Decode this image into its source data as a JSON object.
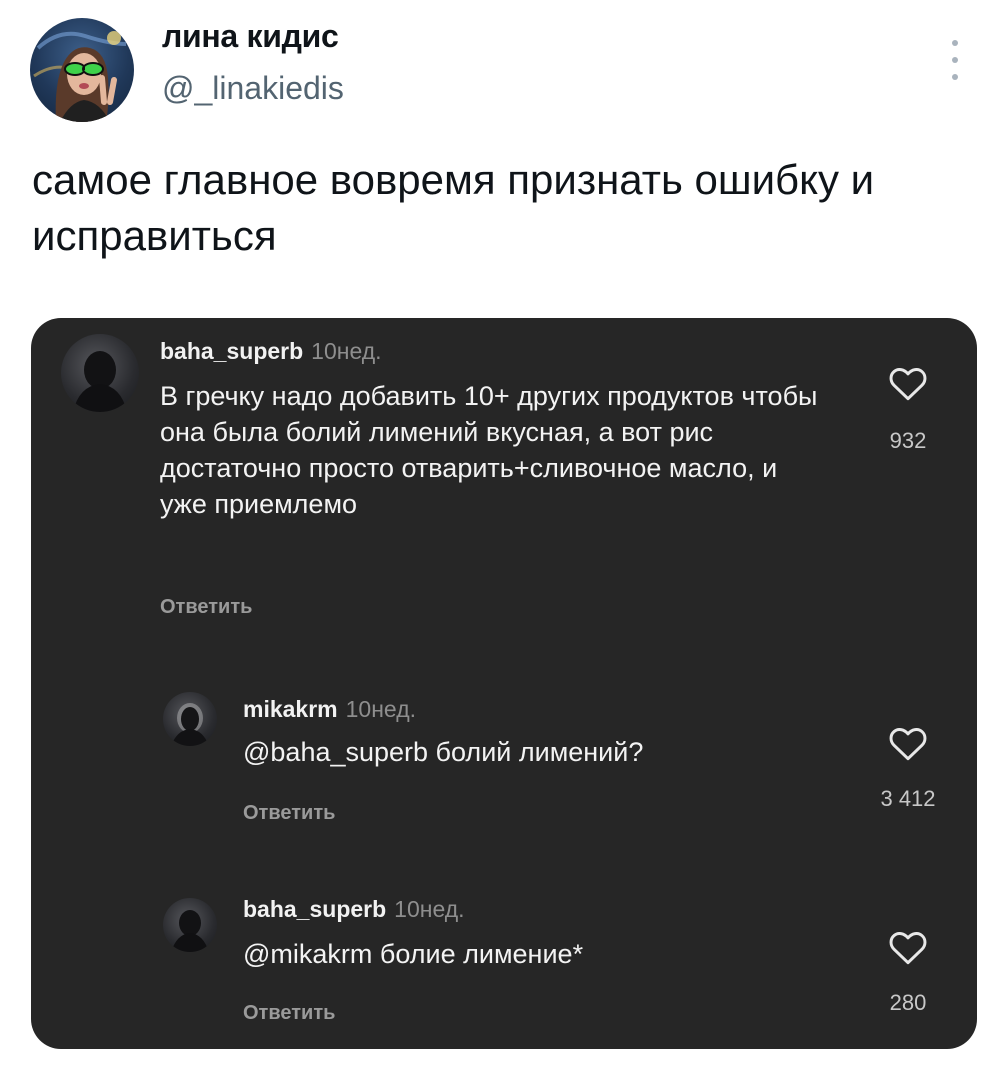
{
  "tweet": {
    "author_name": "лина кидис",
    "author_handle": "@_linakiedis",
    "text": "самое главное вовремя признать ошибку и исправиться"
  },
  "comments": [
    {
      "user": "baha_superb",
      "time": "10нед.",
      "text": "В гречку надо добавить 10+ других продуктов чтобы она была болий лимений вкусная, а вот рис достаточно просто отварить+сливочное масло, и уже приемлемо",
      "reply_label": "Ответить",
      "likes": "932"
    },
    {
      "user": "mikakrm",
      "time": "10нед.",
      "text": "@baha_superb болий лимений?",
      "reply_label": "Ответить",
      "likes": "3 412"
    },
    {
      "user": "baha_superb",
      "time": "10нед.",
      "text": "@mikakrm болие лимение*",
      "reply_label": "Ответить",
      "likes": "280"
    }
  ],
  "icons": {
    "more": "more-vertical-icon",
    "like": "heart-outline-icon"
  },
  "colors": {
    "background": "#ffffff",
    "media_background": "#262626",
    "name": "#0f1419",
    "handle": "#536471"
  }
}
